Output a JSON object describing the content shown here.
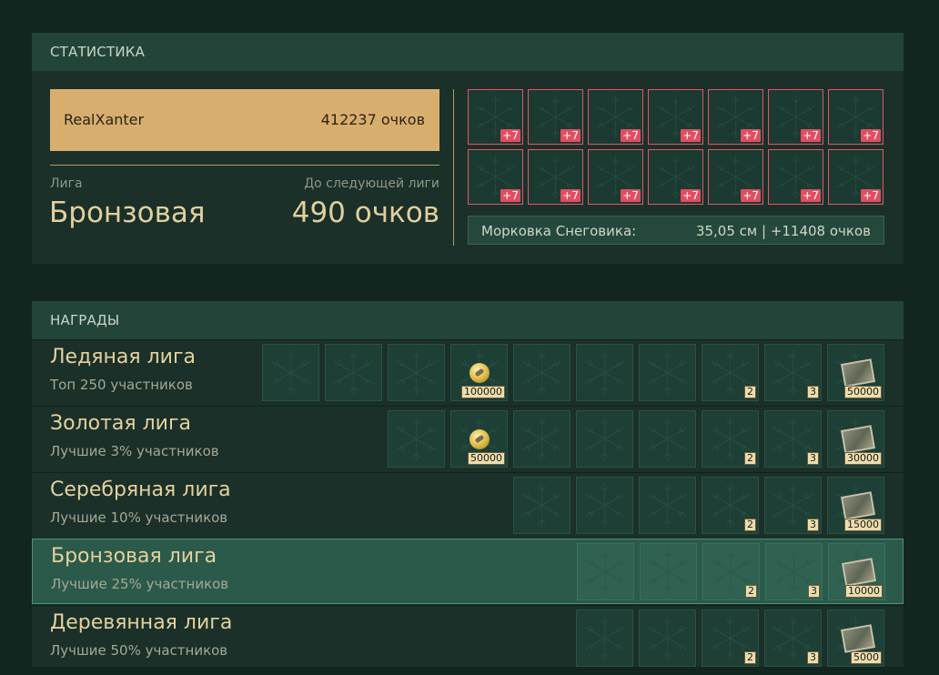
{
  "stats": {
    "header": "СТАТИСТИКА",
    "player_name": "RealXanter",
    "player_score": "412237 очков",
    "league_label": "Лига",
    "league_value": "Бронзовая",
    "next_label": "До следующей лиги",
    "next_value": "490 очков",
    "bonus_cells": [
      "+7",
      "+7",
      "+7",
      "+7",
      "+7",
      "+7",
      "+7",
      "+7",
      "+7",
      "+7",
      "+7",
      "+7",
      "+7",
      "+7"
    ],
    "carrot_label": "Морковка Снеговика:",
    "carrot_value": "35,05 см | +11408 очков"
  },
  "rewards": {
    "header": "НАГРАДЫ",
    "leagues": [
      {
        "title": "Ледяная лига",
        "subtitle": "Топ 250 участников",
        "active": false,
        "cells": [
          {
            "type": "empty"
          },
          {
            "type": "empty"
          },
          {
            "type": "empty"
          },
          {
            "type": "coin",
            "badge": "100000"
          },
          {
            "type": "empty"
          },
          {
            "type": "empty"
          },
          {
            "type": "empty"
          },
          {
            "type": "empty",
            "badge": "2"
          },
          {
            "type": "empty",
            "badge": "3"
          },
          {
            "type": "card",
            "badge": "50000"
          }
        ]
      },
      {
        "title": "Золотая лига",
        "subtitle": "Лучшие 3% участников",
        "active": false,
        "cells": [
          {
            "type": "empty"
          },
          {
            "type": "coin",
            "badge": "50000"
          },
          {
            "type": "empty"
          },
          {
            "type": "empty"
          },
          {
            "type": "empty"
          },
          {
            "type": "empty",
            "badge": "2"
          },
          {
            "type": "empty",
            "badge": "3"
          },
          {
            "type": "card",
            "badge": "30000"
          }
        ]
      },
      {
        "title": "Серебряная лига",
        "subtitle": "Лучшие 10% участников",
        "active": false,
        "cells": [
          {
            "type": "empty"
          },
          {
            "type": "empty"
          },
          {
            "type": "empty"
          },
          {
            "type": "empty",
            "badge": "2"
          },
          {
            "type": "empty",
            "badge": "3"
          },
          {
            "type": "card",
            "badge": "15000"
          }
        ]
      },
      {
        "title": "Бронзовая лига",
        "subtitle": "Лучшие 25% участников",
        "active": true,
        "cells": [
          {
            "type": "empty"
          },
          {
            "type": "empty"
          },
          {
            "type": "empty",
            "badge": "2"
          },
          {
            "type": "empty",
            "badge": "3"
          },
          {
            "type": "card",
            "badge": "10000"
          }
        ]
      },
      {
        "title": "Деревянная лига",
        "subtitle": "Лучшие 50% участников",
        "active": false,
        "cells": [
          {
            "type": "empty"
          },
          {
            "type": "empty"
          },
          {
            "type": "empty",
            "badge": "2"
          },
          {
            "type": "empty",
            "badge": "3"
          },
          {
            "type": "card",
            "badge": "5000"
          }
        ]
      }
    ]
  }
}
